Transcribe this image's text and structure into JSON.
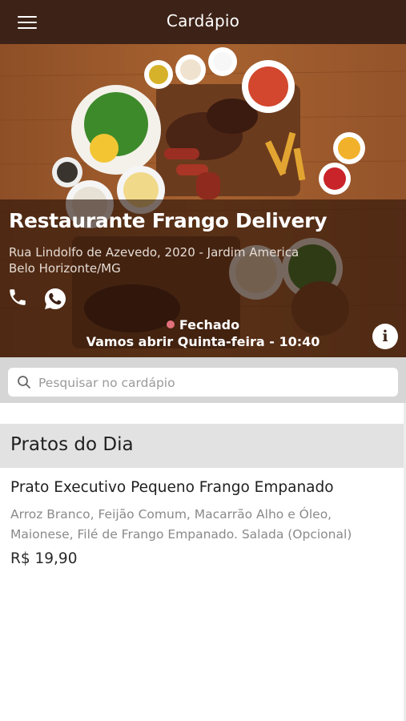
{
  "header": {
    "title": "Cardápio",
    "menu_icon": "hamburger-menu-icon"
  },
  "restaurant": {
    "name": "Restaurante Frango Delivery",
    "address_line1": "Rua Lindolfo de Azevedo, 2020 - Jardim America",
    "address_line2": "Belo Horizonte/MG",
    "contact_icons": [
      "phone-icon",
      "whatsapp-icon"
    ],
    "status": "Fechado",
    "status_color": "#e0707a",
    "opening": "Vamos abrir Quinta-feira - 10:40",
    "info_icon": "info-icon"
  },
  "search": {
    "placeholder": "Pesquisar no cardápio",
    "value": ""
  },
  "menu": {
    "section_title": "Pratos do Dia",
    "items": [
      {
        "name": "Prato Executivo Pequeno Frango Empanado",
        "description_line1": "Arroz Branco, Feijão Comum, Macarrão Alho e Óleo,",
        "description_line2": "Maionese, Filé de Frango Empanado. Salada (Opcional)",
        "price": "R$ 19,90"
      }
    ]
  },
  "colors": {
    "topbar": "#3d2217",
    "section_bg": "#e2e2e2",
    "search_bg": "#d6d6d6"
  }
}
